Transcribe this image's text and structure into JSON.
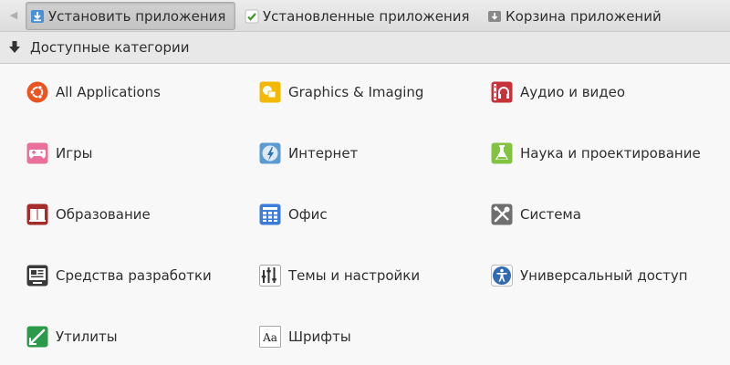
{
  "toolbar": {
    "install_label": "Установить приложения",
    "installed_label": "Установленные приложения",
    "trash_label": "Корзина приложений"
  },
  "header": {
    "title": "Доступные категории"
  },
  "categories": [
    {
      "label": "All Applications",
      "icon": "ubuntu-icon"
    },
    {
      "label": "Graphics & Imaging",
      "icon": "graphics-icon"
    },
    {
      "label": "Аудио и видео",
      "icon": "audio-video-icon"
    },
    {
      "label": "Игры",
      "icon": "gamepad-icon"
    },
    {
      "label": "Интернет",
      "icon": "internet-icon"
    },
    {
      "label": "Наука и проектирование",
      "icon": "flask-icon"
    },
    {
      "label": "Образование",
      "icon": "book-icon"
    },
    {
      "label": "Офис",
      "icon": "office-icon"
    },
    {
      "label": "Система",
      "icon": "tools-icon"
    },
    {
      "label": "Средства разработки",
      "icon": "developer-icon"
    },
    {
      "label": "Темы и настройки",
      "icon": "themes-icon"
    },
    {
      "label": "Универсальный доступ",
      "icon": "accessibility-icon"
    },
    {
      "label": "Утилиты",
      "icon": "utilities-icon"
    },
    {
      "label": "Шрифты",
      "icon": "fonts-icon"
    }
  ],
  "colors": {
    "ubuntu_orange": "#e95420",
    "graphics_yellow": "#f5b800",
    "media_red": "#c7333a",
    "games_pink": "#e8709a",
    "internet_blue": "#5d9ad0",
    "science_green": "#82c341",
    "education_red": "#a62b2b",
    "office_blue": "#3b7dd8",
    "system_gray": "#6f6f6f",
    "access_blue": "#2f6ab3",
    "utilities_green": "#2b9a4a"
  }
}
